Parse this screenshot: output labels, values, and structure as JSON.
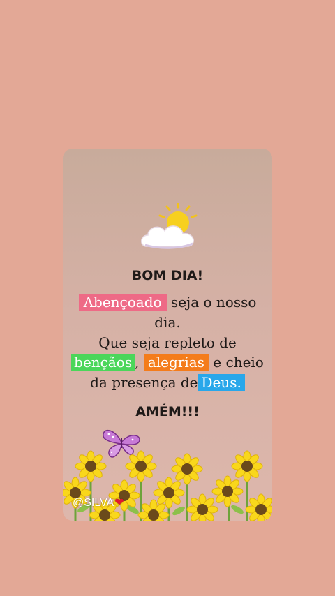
{
  "greeting": "BOM DIA!",
  "verse": {
    "line1_highlight": "Abençoado",
    "line1_rest": " seja o nosso",
    "line2": "dia.",
    "line3": "Que seja repleto de",
    "line4_h1": "bençãos",
    "line4_sep": ",",
    "line4_h2": "alegrias",
    "line4_rest": "  e cheio",
    "line5_start": "da presença de",
    "line5_highlight": "Deus."
  },
  "closing": "AMÉM!!!",
  "watermark": "@SILVA",
  "watermark_heart": "❤",
  "colors": {
    "background": "#e3a896",
    "pink_highlight": "#ee6a86",
    "green_highlight": "#4bd65a",
    "orange_highlight": "#f47c1b",
    "blue_highlight": "#28a7ea"
  },
  "icons": [
    "sun-behind-cloud-icon",
    "butterfly-icon",
    "sunflower-icon"
  ]
}
